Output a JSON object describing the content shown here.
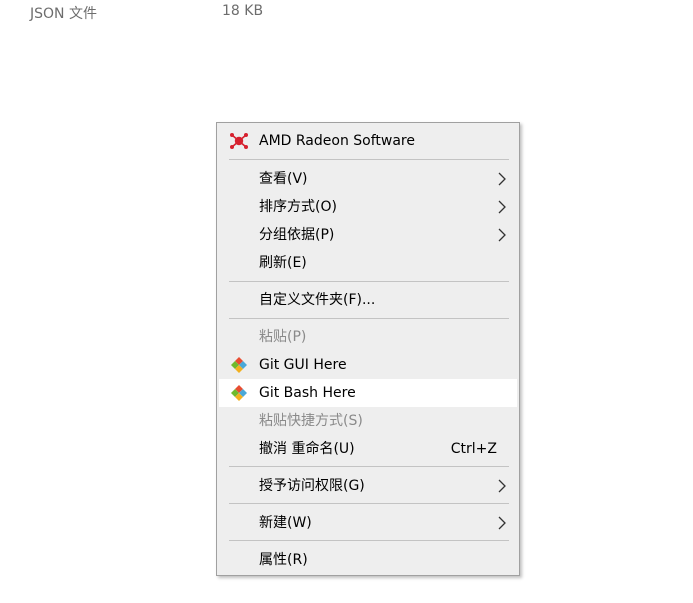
{
  "file_row": {
    "type": "JSON 文件",
    "size": "18 KB"
  },
  "menu": {
    "amd": "AMD Radeon Software",
    "view": "查看(V)",
    "sort_by": "排序方式(O)",
    "group_by": "分组依据(P)",
    "refresh": "刷新(E)",
    "customize": "自定义文件夹(F)...",
    "paste": "粘贴(P)",
    "git_gui": "Git GUI Here",
    "git_bash": "Git Bash Here",
    "paste_shortcut": "粘贴快捷方式(S)",
    "undo_rename": "撤消 重命名(U)",
    "undo_shortcut": "Ctrl+Z",
    "give_access": "授予访问权限(G)",
    "new": "新建(W)",
    "properties": "属性(R)"
  },
  "colors": {
    "menu_bg": "#eeeeee",
    "hover_bg": "#ffffff",
    "disabled_text": "#8a8a8a",
    "amd_red": "#d6212f"
  },
  "icons": {
    "amd": "amd-radeon-icon",
    "git": "git-icon",
    "submenu": "chevron-right-icon"
  }
}
